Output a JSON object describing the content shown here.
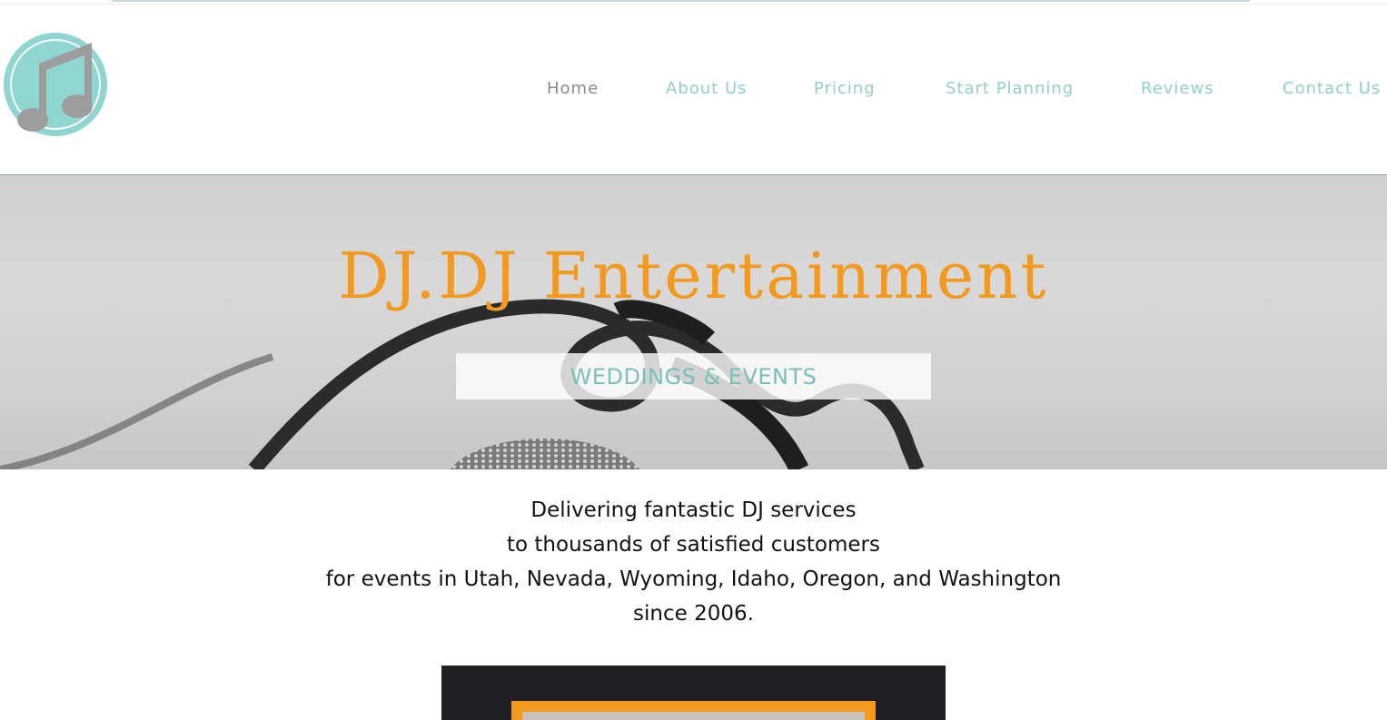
{
  "brand": {
    "logo_icon": "music-note-icon",
    "accent": "#8fd0c9",
    "orange": "#f39a1e"
  },
  "nav": {
    "items": [
      {
        "label": "Home",
        "active": true
      },
      {
        "label": "About Us",
        "active": false
      },
      {
        "label": "Pricing",
        "active": false
      },
      {
        "label": "Start Planning",
        "active": false
      },
      {
        "label": "Reviews",
        "active": false
      },
      {
        "label": "Contact Us",
        "active": false
      }
    ]
  },
  "hero": {
    "title": "DJ.DJ Entertainment",
    "subtitle": "WEDDINGS & EVENTS",
    "background_icon": "microphone-icon"
  },
  "tagline": {
    "lines": [
      "Delivering fantastic DJ services",
      "to thousands of satisfied customers",
      "for events in Utah, Nevada, Wyoming, Idaho, Oregon, and Washington",
      "since 2006."
    ]
  },
  "media": {
    "frame_color": "#f39a1e"
  }
}
